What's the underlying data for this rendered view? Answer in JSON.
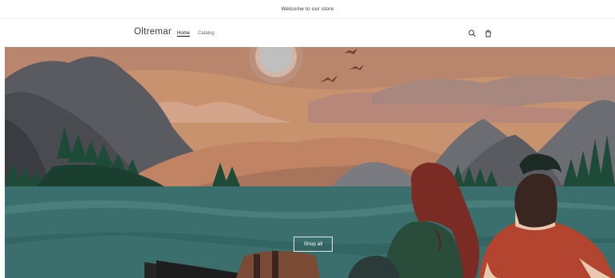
{
  "announcement": {
    "text": "Welcome to our store"
  },
  "header": {
    "brand": "Oltremar",
    "nav": [
      {
        "label": "Home",
        "active": true
      },
      {
        "label": "Catalog",
        "active": false
      }
    ],
    "icons": [
      "search-icon",
      "cart-icon"
    ]
  },
  "hero": {
    "button_label": "Shop all"
  },
  "colors": {
    "sky": "#c9926f",
    "cloud": "#b88d78",
    "mountain_dark": "#5d5e63",
    "mountain_mid": "#727277",
    "water": "#3b6f6e",
    "forest": "#1e4a38",
    "skin_dark": "#3a2620",
    "shirt_red": "#b3442f",
    "shirt_green": "#2a4c3a",
    "hair_red": "#7a2c24"
  }
}
